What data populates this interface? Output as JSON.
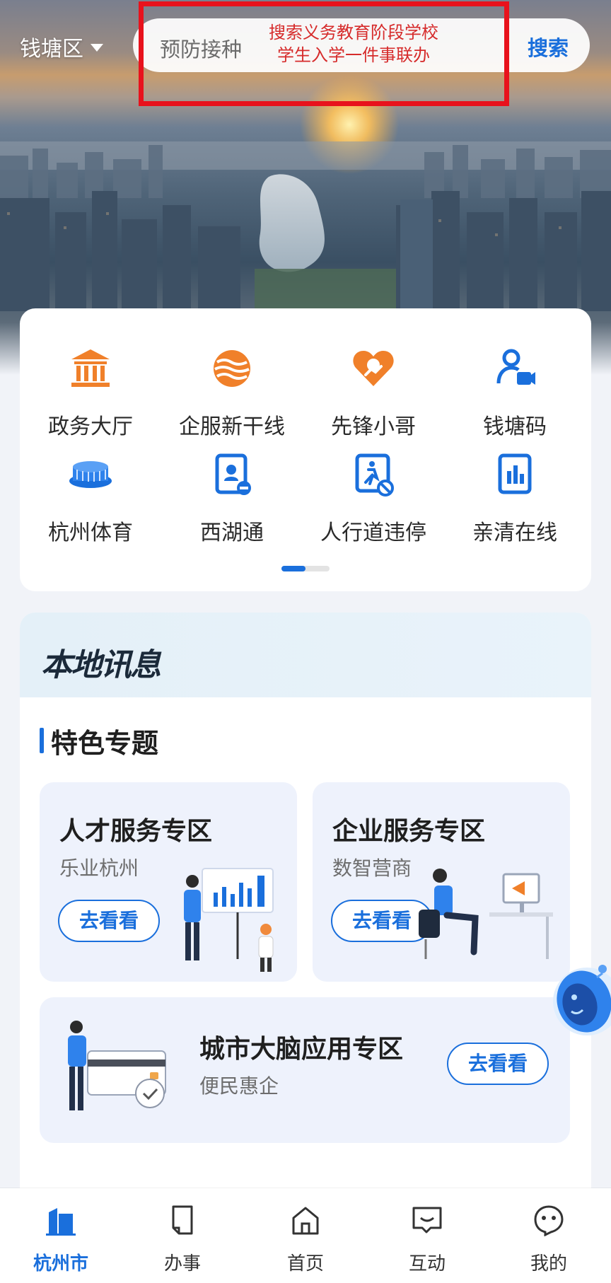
{
  "header": {
    "district": "钱塘区",
    "search_placeholder": "预防接种",
    "search_button": "搜索",
    "annotation_line1": "搜索义务教育阶段学校",
    "annotation_line2": "学生入学一件事联办"
  },
  "services": [
    {
      "label": "政务大厅",
      "icon": "government-hall-icon"
    },
    {
      "label": "企服新干线",
      "icon": "enterprise-service-icon"
    },
    {
      "label": "先锋小哥",
      "icon": "vanguard-courier-icon"
    },
    {
      "label": "钱塘码",
      "icon": "qiantang-code-icon"
    },
    {
      "label": "杭州体育",
      "icon": "stadium-icon"
    },
    {
      "label": "西湖通",
      "icon": "xihu-pass-icon"
    },
    {
      "label": "人行道违停",
      "icon": "sidewalk-parking-icon"
    },
    {
      "label": "亲清在线",
      "icon": "qinqing-online-icon"
    }
  ],
  "pager": {
    "current_page": 1,
    "pages": 2
  },
  "local_news": {
    "logo": "本地讯息",
    "section_title": "特色专题"
  },
  "tiles": [
    {
      "title": "人才服务专区",
      "subtitle": "乐业杭州",
      "button": "去看看"
    },
    {
      "title": "企业服务专区",
      "subtitle": "数智营商",
      "button": "去看看"
    },
    {
      "title": "城市大脑应用专区",
      "subtitle": "便民惠企",
      "button": "去看看"
    }
  ],
  "bottom_nav": [
    {
      "label": "杭州市",
      "icon": "city-buildings-icon",
      "active": true
    },
    {
      "label": "办事",
      "icon": "document-icon",
      "active": false
    },
    {
      "label": "首页",
      "icon": "home-icon",
      "active": false
    },
    {
      "label": "互动",
      "icon": "chat-icon",
      "active": false
    },
    {
      "label": "我的",
      "icon": "profile-icon",
      "active": false
    }
  ],
  "colors": {
    "accent": "#1a6fdc",
    "orange": "#f0802a",
    "annotation": "#e8121c"
  }
}
